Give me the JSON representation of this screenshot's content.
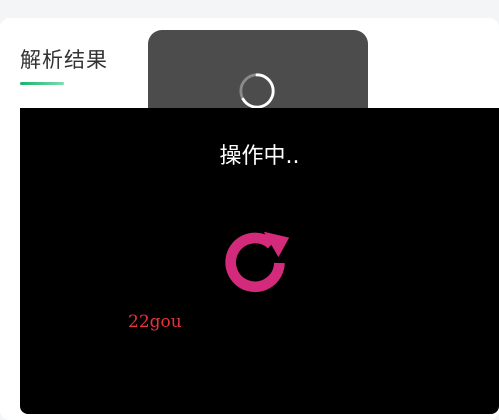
{
  "result": {
    "title": "解析结果"
  },
  "toast": {
    "spinner_icon": "loading-spinner-icon",
    "label": "操作中.."
  },
  "player": {
    "reload_icon": "reload-icon",
    "watermark": "22gou"
  },
  "colors": {
    "accent_green": "#16b36e",
    "reload_pink": "#d42a7c",
    "watermark_red": "#e8323a",
    "toast_bg": "#4c4c4c",
    "player_bg": "#000000"
  }
}
